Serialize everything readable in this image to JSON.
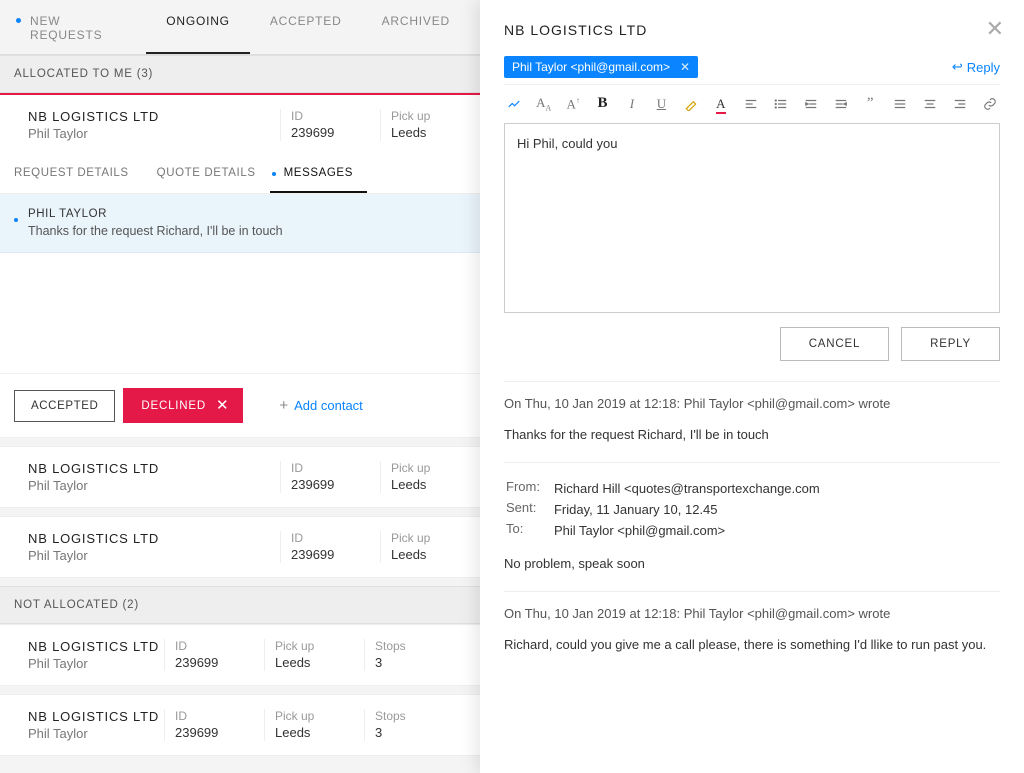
{
  "tabs": {
    "new_requests": "NEW REQUESTS",
    "ongoing": "ONGOING",
    "accepted": "ACCEPTED",
    "archived": "ARCHIVED"
  },
  "sections": {
    "allocated": "ALLOCATED TO ME (3)",
    "not_allocated": "NOT ALLOCATED (2)"
  },
  "selected": {
    "company": "NB LOGISTICS LTD",
    "person": "Phil Taylor",
    "id_label": "ID",
    "id": "239699",
    "pickup_label": "Pick up",
    "pickup": "Leeds",
    "subtabs": {
      "request": "REQUEST DETAILS",
      "quote": "QUOTE DETAILS",
      "messages": "MESSAGES"
    },
    "msg_from": "PHIL TAYLOR",
    "msg_text": "Thanks for the request Richard, I'll be in touch",
    "btn_accepted": "ACCEPTED",
    "btn_declined": "DECLINED",
    "add_contact": "Add contact"
  },
  "cards": [
    {
      "company": "NB LOGISTICS LTD",
      "person": "Phil Taylor",
      "id_label": "ID",
      "id": "239699",
      "pickup_label": "Pick up",
      "pickup": "Leeds"
    },
    {
      "company": "NB LOGISTICS LTD",
      "person": "Phil Taylor",
      "id_label": "ID",
      "id": "239699",
      "pickup_label": "Pick up",
      "pickup": "Leeds"
    }
  ],
  "na_cards": [
    {
      "company": "NB LOGISTICS LTD",
      "person": "Phil Taylor",
      "id_label": "ID",
      "id": "239699",
      "pickup_label": "Pick up",
      "pickup": "Leeds",
      "stops_label": "Stops",
      "stops": "3"
    },
    {
      "company": "NB LOGISTICS LTD",
      "person": "Phil Taylor",
      "id_label": "ID",
      "id": "239699",
      "pickup_label": "Pick up",
      "pickup": "Leeds",
      "stops_label": "Stops",
      "stops": "3"
    }
  ],
  "panel": {
    "title": "NB LOGISTICS LTD",
    "chip": "Phil Taylor <phil@gmail.com>",
    "reply": "Reply",
    "draft": "Hi Phil, could you",
    "cancel": "CANCEL",
    "reply_btn": "REPLY",
    "thread1_meta": "On Thu, 10 Jan 2019 at 12:18: Phil Taylor <phil@gmail.com> wrote",
    "thread1_body": "Thanks for the request Richard, I'll be in touch",
    "from_label": "From:",
    "from_value": "Richard Hill <quotes@transportexchange.com",
    "sent_label": "Sent:",
    "sent_value": "Friday, 11 January 10, 12.45",
    "to_label": "To:",
    "to_value": "Phil Taylor <phil@gmail.com>",
    "thread2_body": "No problem, speak soon",
    "thread3_meta": "On Thu, 10 Jan 2019 at 12:18: Phil Taylor <phil@gmail.com> wrote",
    "thread3_body": "Richard, could you give me a call please, there is something I'd llike to run past you."
  }
}
